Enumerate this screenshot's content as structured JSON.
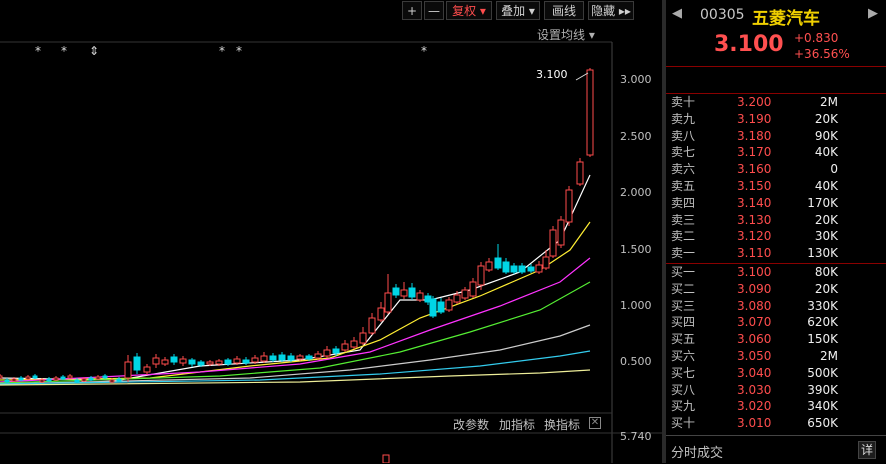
{
  "toolbar": {
    "plus": "+",
    "minus": "—",
    "fuquan": "复权 ▾",
    "diejia": "叠加 ▾",
    "huaxian": "画线",
    "yincang": "隐藏 ▸▸",
    "settings": "设置均线 ▾"
  },
  "chart": {
    "last_price_label": "3.100",
    "y_axis_labels": [
      "3.000",
      "2.500",
      "2.000",
      "1.500",
      "1.000",
      "0.500"
    ],
    "volume_axis_label": "5.740",
    "markers": [
      "*",
      "*",
      "⇕",
      "*",
      "*",
      "*"
    ]
  },
  "chart_bottom": {
    "change_params": "改参数",
    "add_indicator": "加指标",
    "switch_indicator": "换指标"
  },
  "quote": {
    "code": "00305",
    "name": "五菱汽车",
    "price": "3.100",
    "change": "+0.830",
    "change_pct": "+36.56%",
    "sell": [
      {
        "label": "卖十",
        "price": "3.200",
        "vol": "2M"
      },
      {
        "label": "卖九",
        "price": "3.190",
        "vol": "20K"
      },
      {
        "label": "卖八",
        "price": "3.180",
        "vol": "90K"
      },
      {
        "label": "卖七",
        "price": "3.170",
        "vol": "40K"
      },
      {
        "label": "卖六",
        "price": "3.160",
        "vol": "0"
      },
      {
        "label": "卖五",
        "price": "3.150",
        "vol": "40K"
      },
      {
        "label": "卖四",
        "price": "3.140",
        "vol": "170K"
      },
      {
        "label": "卖三",
        "price": "3.130",
        "vol": "20K"
      },
      {
        "label": "卖二",
        "price": "3.120",
        "vol": "30K"
      },
      {
        "label": "卖一",
        "price": "3.110",
        "vol": "130K"
      }
    ],
    "buy": [
      {
        "label": "买一",
        "price": "3.100",
        "vol": "80K"
      },
      {
        "label": "买二",
        "price": "3.090",
        "vol": "20K"
      },
      {
        "label": "买三",
        "price": "3.080",
        "vol": "330K"
      },
      {
        "label": "买四",
        "price": "3.070",
        "vol": "620K"
      },
      {
        "label": "买五",
        "price": "3.060",
        "vol": "150K"
      },
      {
        "label": "买六",
        "price": "3.050",
        "vol": "2M"
      },
      {
        "label": "买七",
        "price": "3.040",
        "vol": "500K"
      },
      {
        "label": "买八",
        "price": "3.030",
        "vol": "390K"
      },
      {
        "label": "买九",
        "price": "3.020",
        "vol": "340K"
      },
      {
        "label": "买十",
        "price": "3.010",
        "vol": "650K"
      }
    ],
    "ticks_label": "分时成交",
    "detail": "详"
  },
  "colors": {
    "up": "#ff4d4d",
    "down": "#00d5e5",
    "name": "#f0d000"
  }
}
